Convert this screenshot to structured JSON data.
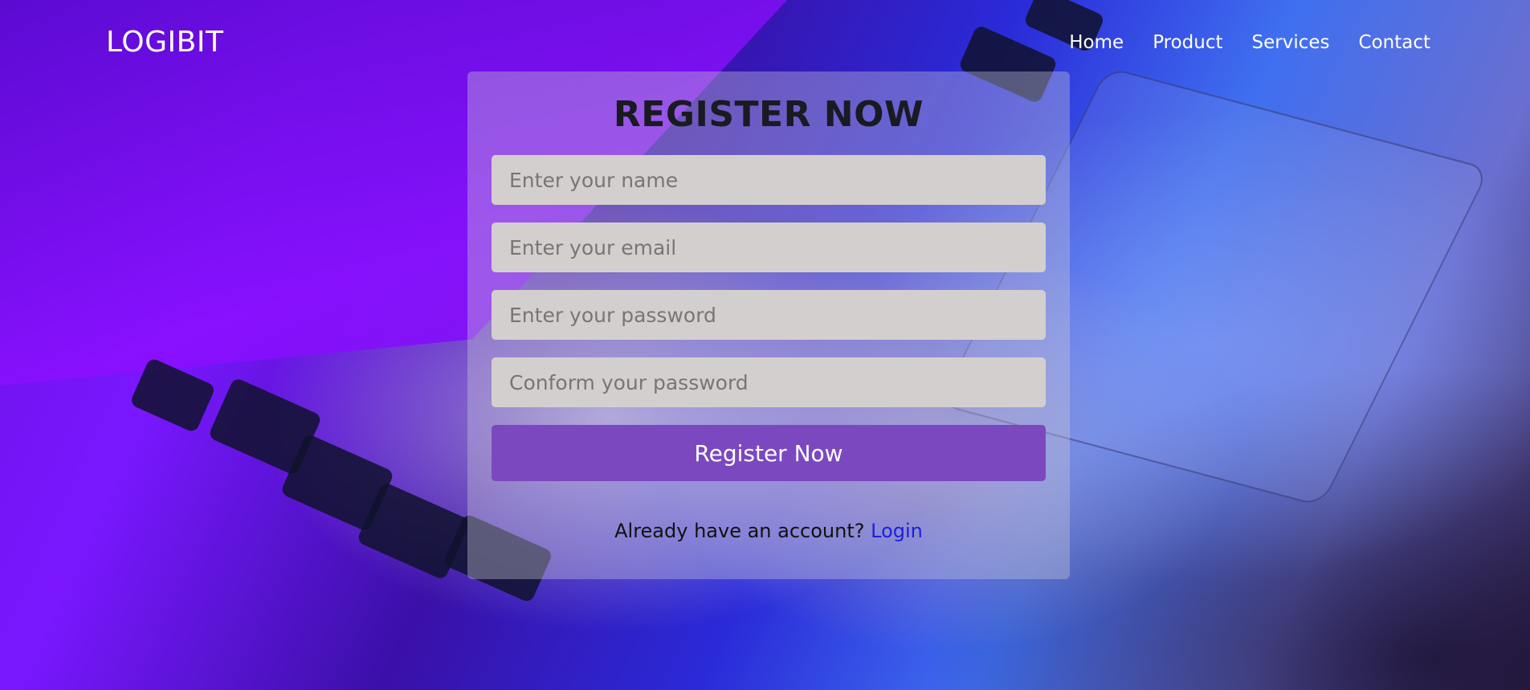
{
  "header": {
    "logo": "LOGIBIT",
    "nav": [
      {
        "label": "Home"
      },
      {
        "label": "Product"
      },
      {
        "label": "Services"
      },
      {
        "label": "Contact"
      }
    ]
  },
  "form": {
    "title": "REGISTER NOW",
    "fields": [
      {
        "placeholder": "Enter your name",
        "value": ""
      },
      {
        "placeholder": "Enter your email",
        "value": ""
      },
      {
        "placeholder": "Enter your password",
        "value": ""
      },
      {
        "placeholder": "Conform your password",
        "value": ""
      }
    ],
    "submit_label": "Register Now",
    "account_prompt": "Already have an account?",
    "login_link": "Login"
  },
  "colors": {
    "card_bg": "#c8c8d7",
    "field_bg": "#d4cfcf",
    "button_bg": "#7b48c0",
    "link": "#1d1fd8",
    "nav_text": "#ffffff"
  }
}
